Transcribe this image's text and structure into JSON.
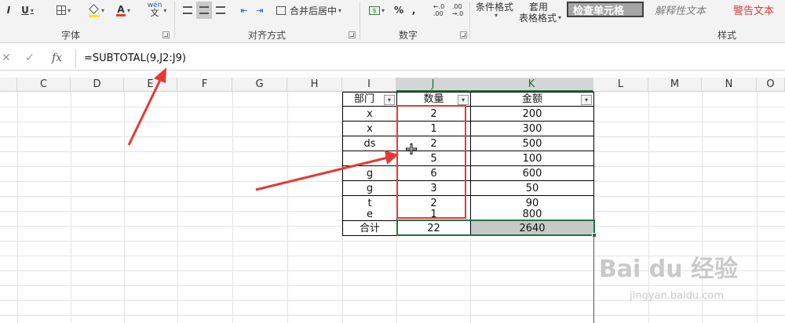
{
  "ribbon": {
    "font_group": "字体",
    "align_group": "对齐方式",
    "number_group": "数字",
    "styles_group": "样式",
    "bold_label": "I",
    "underline_label": "U",
    "merge_label": "合并后居中",
    "percent_label": "%",
    "comma_label": ",",
    "cond_format_label": "条件格式",
    "apply_label_1": "套用",
    "apply_label_2": "表格格式",
    "style_check": "检查单元格",
    "style_explain": "解释性文本",
    "style_warning": "警告文本",
    "wen_label": "wén"
  },
  "formula_bar": {
    "fx_label": "fx",
    "formula": "=SUBTOTAL(9,J2:J9)"
  },
  "columns": [
    "C",
    "D",
    "E",
    "F",
    "G",
    "H",
    "I",
    "J",
    "K",
    "L",
    "M",
    "N",
    "O"
  ],
  "table": {
    "headers": [
      "部门",
      "数量",
      "金额"
    ],
    "rows": [
      [
        "x",
        "2",
        "200"
      ],
      [
        "x",
        "1",
        "300"
      ],
      [
        "ds",
        "2",
        "500"
      ],
      [
        "",
        "5",
        "100"
      ],
      [
        "g",
        "6",
        "600"
      ],
      [
        "g",
        "3",
        "50"
      ],
      [
        "t",
        "2",
        "90"
      ],
      [
        "e",
        "1",
        "800"
      ]
    ],
    "total": [
      "合计",
      "22",
      "2640"
    ]
  },
  "watermark": {
    "brand": "Bai du 经验",
    "url": "jingyan.baidu.com"
  },
  "colors": {
    "accent": "#217346",
    "highlight": "#e53935",
    "arrow": "#e53935"
  }
}
